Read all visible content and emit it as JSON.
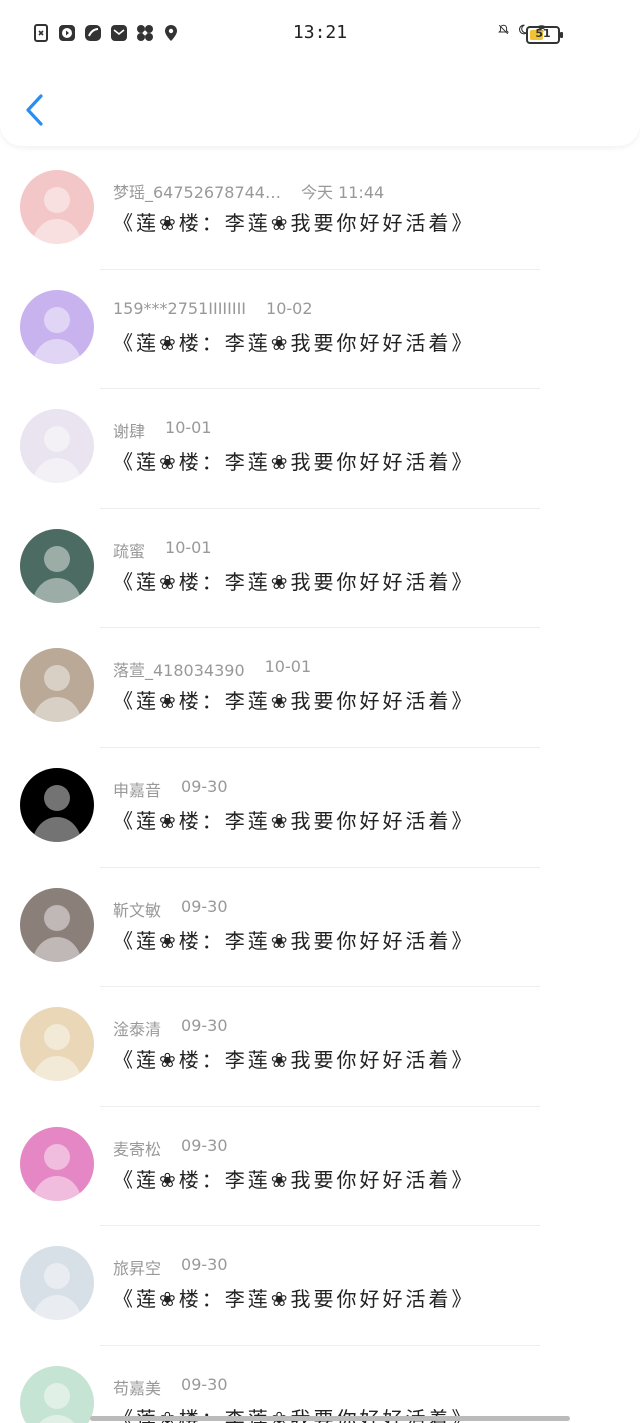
{
  "status_bar": {
    "time": "13:21",
    "battery_level": "51",
    "battery_fraction": 0.51,
    "left_icons": [
      "sim-icon",
      "play-icon",
      "app-icon",
      "mail-icon",
      "fan-icon",
      "location-icon"
    ],
    "right_icons": [
      "mute-icon",
      "moon-icon",
      "wifi-icon",
      "battery-icon"
    ]
  },
  "header": {
    "back_icon": "chevron-left-icon",
    "accent_color": "#2b8cf2"
  },
  "messages": [
    {
      "name": "梦瑶_64752678744…",
      "time": "今天 11:44",
      "text": "《莲❀楼：李莲❀我要你好好活着》",
      "avatar_color": "#f3c7c7"
    },
    {
      "name": "159***2751IIIIIIII",
      "time": "10-02",
      "text": "《莲❀楼：李莲❀我要你好好活着》",
      "avatar_color": "#c9b3ef"
    },
    {
      "name": "谢肆",
      "time": "10-01",
      "text": "《莲❀楼：李莲❀我要你好好活着》",
      "avatar_color": "#e9e4ef"
    },
    {
      "name": "疏蜜",
      "time": "10-01",
      "text": "《莲❀楼：李莲❀我要你好好活着》",
      "avatar_color": "#4c6b62"
    },
    {
      "name": "落萱_418034390",
      "time": "10-01",
      "text": "《莲❀楼：李莲❀我要你好好活着》",
      "avatar_color": "#b9a996"
    },
    {
      "name": "申嘉音",
      "time": "09-30",
      "text": "《莲❀楼：李莲❀我要你好好活着》",
      "avatar_color": "#000000"
    },
    {
      "name": "靳文敏",
      "time": "09-30",
      "text": "《莲❀楼：李莲❀我要你好好活着》",
      "avatar_color": "#8b7f7a"
    },
    {
      "name": "淦泰清",
      "time": "09-30",
      "text": "《莲❀楼：李莲❀我要你好好活着》",
      "avatar_color": "#e9d7b7"
    },
    {
      "name": "麦寄松",
      "time": "09-30",
      "text": "《莲❀楼：李莲❀我要你好好活着》",
      "avatar_color": "#e487c4"
    },
    {
      "name": "旅昇空",
      "time": "09-30",
      "text": "《莲❀楼：李莲❀我要你好好活着》",
      "avatar_color": "#d7dfe7"
    },
    {
      "name": "苟嘉美",
      "time": "09-30",
      "text": "《莲❀楼：李莲❀我要你好好活着》",
      "avatar_color": "#c6e4d3"
    }
  ]
}
